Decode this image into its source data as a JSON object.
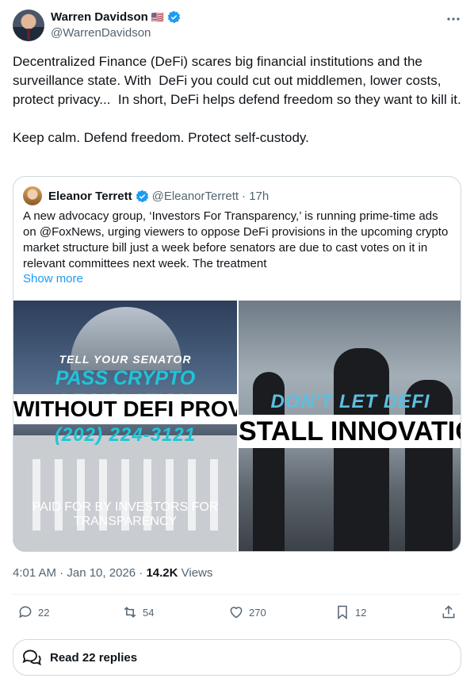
{
  "author": {
    "name": "Warren Davidson",
    "flag": "🇺🇸",
    "handle": "@WarrenDavidson"
  },
  "post": {
    "text": "Decentralized Finance (DeFi) scares big financial institutions and the surveillance state. With  DeFi you could cut out middlemen, lower costs, protect privacy...  In short, DeFi helps defend freedom so they want to kill it.\n\nKeep calm. Defend freedom. Protect self-custody."
  },
  "quote": {
    "name": "Eleanor Terrett",
    "handle": "@EleanorTerrett",
    "time": "· 17h",
    "text": "A new advocacy group, ‘Investors For Transparency,’ is running prime-time ads on @FoxNews, urging viewers to oppose DeFi provisions in the upcoming crypto market structure bill just a week before senators are due to cast votes on it in relevant committees next week. The treatment",
    "show_more": "Show more",
    "media": {
      "left": {
        "line1": "TELL YOUR SENATOR",
        "line2": "PASS CRYPTO LEGISLATION",
        "line3": "WITHOUT DEFI PROVISIONS",
        "phone": "(202) 224-3121",
        "paid": "PAID FOR BY INVESTORS FOR TRANSPARENCY"
      },
      "right": {
        "line1": "DON'T LET DEFI",
        "line2": "STALL INNOVATION"
      }
    }
  },
  "meta": {
    "time": "4:01 AM · Jan 10, 2026 · ",
    "views_count": "14.2K",
    "views_label": " Views"
  },
  "actions": {
    "replies": "22",
    "reposts": "54",
    "likes": "270",
    "bookmarks": "12"
  },
  "read_replies": "Read 22 replies",
  "colors": {
    "accent": "#1d9bf0",
    "secondary_text": "#536471",
    "banner_cyan": "#1ec5d8"
  }
}
